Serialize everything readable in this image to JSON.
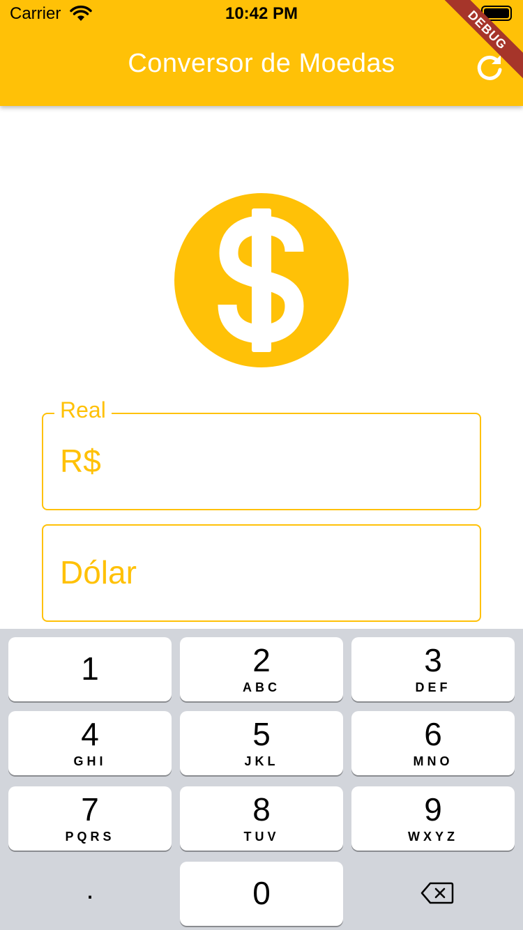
{
  "status_bar": {
    "carrier": "Carrier",
    "time": "10:42 PM"
  },
  "app_bar": {
    "title": "Conversor de Moedas",
    "refresh_icon": "refresh-icon",
    "debug_banner": "DEBUG"
  },
  "hero_icon": "dollar-coin-icon",
  "colors": {
    "accent": "#FFC107",
    "debug": "#A6352A",
    "keyboard_bg": "#D2D5DB"
  },
  "fields": {
    "real": {
      "label": "Real",
      "prefix": "R$"
    },
    "dolar": {
      "placeholder": "Dólar"
    }
  },
  "keyboard": {
    "keys": [
      {
        "num": "1",
        "letters": ""
      },
      {
        "num": "2",
        "letters": "ABC"
      },
      {
        "num": "3",
        "letters": "DEF"
      },
      {
        "num": "4",
        "letters": "GHI"
      },
      {
        "num": "5",
        "letters": "JKL"
      },
      {
        "num": "6",
        "letters": "MNO"
      },
      {
        "num": "7",
        "letters": "PQRS"
      },
      {
        "num": "8",
        "letters": "TUV"
      },
      {
        "num": "9",
        "letters": "WXYZ"
      },
      {
        "num": "0",
        "letters": ""
      }
    ],
    "decimal": ".",
    "delete_icon": "backspace-icon"
  }
}
